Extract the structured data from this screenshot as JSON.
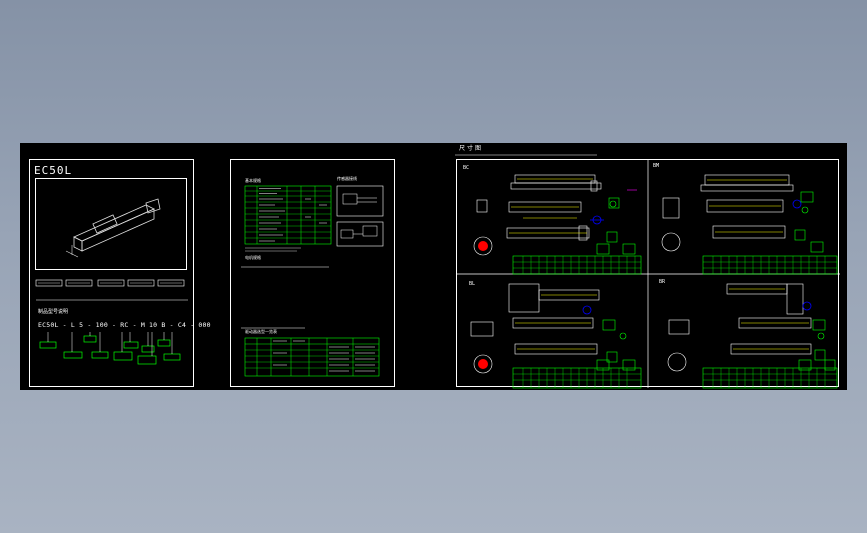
{
  "sheet1": {
    "title": "EC50L",
    "model_heading": "制品型号说明",
    "model_code": "EC50L - L 5 - 100 - RC - M 10 B - C4 - 000"
  },
  "sheet2": {
    "spec_heading": "基本规格",
    "wiring_heading": "传感器接线",
    "motor_heading": "电机规格",
    "encoder_heading": "驱动器选型一览表"
  },
  "sheet3": {
    "heading": "尺寸图",
    "views": [
      "BC",
      "BM",
      "BL",
      "BR"
    ]
  },
  "colors": {
    "canvas": "#000000",
    "line": "#ffffff",
    "accent": "#00ff00",
    "desktop": "#98a4b6"
  }
}
